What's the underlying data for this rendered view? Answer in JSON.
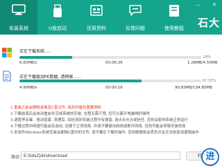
{
  "window": {
    "minimize_label": "—",
    "close_label": "✕"
  },
  "brand": {
    "name": "石大",
    "site": "···"
  },
  "tabs": [
    {
      "label": "安装系统",
      "icon": "monitor-icon",
      "active": true
    },
    {
      "label": "U盘启动",
      "icon": "usb-icon"
    },
    {
      "label": "还原资料",
      "icon": "restore-icon"
    },
    {
      "label": "反馈问题",
      "icon": "chat-icon"
    },
    {
      "label": "使用教程",
      "icon": "book-icon"
    }
  ],
  "tasks": [
    {
      "title": "正在下载系统.....",
      "progress_percent": 29,
      "percent_text": "29%",
      "downloaded": "6.82MB/s",
      "time": "00:06:26",
      "size": "1.28MB/4.55MB",
      "icon": "windows-logo-icon"
    },
    {
      "title": "正在下载驱动PE数据, 请稍候......",
      "progress_percent": 67,
      "percent_text": "67.32%",
      "downloaded": "4.90MB/s",
      "time": "00:00:16",
      "size": "90.83MB/134.85MB",
      "icon": "document-icon"
    }
  ],
  "notes": [
    {
      "text": "1.重装之前会删除桌面及C盘文件, 请及时备份重要资料",
      "warning": true
    },
    {
      "text": "2.下载结束后会自动重启并完成系统的安装, 全程无需干预, 您可以离开电脑喝杯咖啡",
      "warning": false
    },
    {
      "text": "3.请暂停杀毒、驱动管家, 清理后, 如检测到安装过程中有弹窗, 请点击允许或信任, 否则会影响系统正常运行",
      "warning": false
    },
    {
      "text": "4.下载过程中网速可能会有波动, 这属于正常现象, 并请不要拔出网线或断开网络, 否则可能会导致安装失败",
      "warning": false
    },
    {
      "text": "5.本软件Windows系统安装会删除C盘中的文件, 请不要在下载时操作, 否则数据将会丢失并且无法恢复请谨慎操作",
      "warning": false
    }
  ],
  "footer": {
    "path_label": "路径:",
    "path_value": "E:\\SdsZjdx\\download",
    "browse_label": "打",
    "logo_glyph": "进"
  },
  "colors": {
    "accent": "#14a58c",
    "warning": "#e2391e"
  }
}
